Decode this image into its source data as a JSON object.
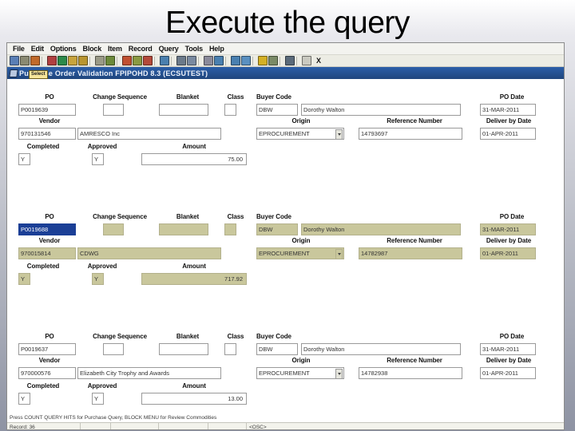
{
  "slide": {
    "title": "Execute the query"
  },
  "window": {
    "title": "Purchase Order Validation  FPIPOHD 8.3  (ECSUTEST)",
    "tooltip": "Select"
  },
  "menubar": {
    "items": [
      "File",
      "Edit",
      "Options",
      "Block",
      "Item",
      "Record",
      "Query",
      "Tools",
      "Help"
    ]
  },
  "toolbar": {
    "close_label": "X",
    "icons": [
      {
        "name": "save-icon",
        "color": "#5a7fb5"
      },
      {
        "name": "rollback-icon",
        "color": "#8a8a72"
      },
      {
        "name": "print-icon",
        "color": "#c06a2a"
      },
      {
        "name": "cut-icon",
        "color": "#b04040"
      },
      {
        "name": "copy-icon",
        "color": "#2d8a4a"
      },
      {
        "name": "paste-icon",
        "color": "#c8a43c"
      },
      {
        "name": "select-all-icon",
        "color": "#b8952f"
      },
      {
        "name": "enter-query-icon",
        "color": "#9a9a86"
      },
      {
        "name": "execute-query-icon",
        "color": "#6c8a3a"
      },
      {
        "name": "cancel-query-icon",
        "color": "#c05030"
      },
      {
        "name": "insert-record-icon",
        "color": "#8a9a42"
      },
      {
        "name": "remove-record-icon",
        "color": "#b44a3a"
      },
      {
        "name": "duplicate-record-icon",
        "color": "#4a7fae"
      },
      {
        "name": "list-values-icon",
        "color": "#6b7a8a"
      },
      {
        "name": "edit-icon",
        "color": "#7a8aa0"
      },
      {
        "name": "show-keys-icon",
        "color": "#8a8a9a"
      },
      {
        "name": "previous-block-icon",
        "color": "#4a80b0"
      },
      {
        "name": "next-block-icon",
        "color": "#4a80b0"
      },
      {
        "name": "previous-item-icon",
        "color": "#5a90c0"
      },
      {
        "name": "next-item-icon",
        "color": "#d4b024"
      },
      {
        "name": "exit-icon",
        "color": "#7a8a66"
      },
      {
        "name": "help-icon",
        "color": "#5a6a7a"
      },
      {
        "name": "window-icon",
        "color": "#c9c9c0"
      }
    ]
  },
  "form": {
    "labels": {
      "po": "PO",
      "change_sequence": "Change Sequence",
      "blanket": "Blanket",
      "class": "Class",
      "buyer_code": "Buyer Code",
      "po_date": "PO Date",
      "vendor": "Vendor",
      "origin": "Origin",
      "reference_number": "Reference Number",
      "deliver_by_date": "Deliver by Date",
      "completed": "Completed",
      "approved": "Approved",
      "amount": "Amount"
    },
    "records": [
      {
        "po": "P0019639",
        "change_sequence": "",
        "blanket": "",
        "class": "",
        "buyer_code": "DBW",
        "buyer_name": "Dorothy Walton",
        "po_date": "31-MAR-2011",
        "vendor_id": "970131546",
        "vendor_name": "AMRESCO Inc",
        "origin": "EPROCUREMENT",
        "reference_number": "14793697",
        "deliver_by_date": "01-APR-2011",
        "completed": "Y",
        "approved": "Y",
        "amount": "75.00",
        "current": false
      },
      {
        "po": "P0019688",
        "change_sequence": "",
        "blanket": "",
        "class": "",
        "buyer_code": "DBW",
        "buyer_name": "Dorothy Walton",
        "po_date": "31-MAR-2011",
        "vendor_id": "970015814",
        "vendor_name": "CDWG",
        "origin": "EPROCUREMENT",
        "reference_number": "14782987",
        "deliver_by_date": "01-APR-2011",
        "completed": "Y",
        "approved": "Y",
        "amount": "717.92",
        "current": true
      },
      {
        "po": "P0019637",
        "change_sequence": "",
        "blanket": "",
        "class": "",
        "buyer_code": "DBW",
        "buyer_name": "Dorothy Walton",
        "po_date": "31-MAR-2011",
        "vendor_id": "970000576",
        "vendor_name": "Elizabeth City Trophy and Awards",
        "origin": "EPROCUREMENT",
        "reference_number": "14782938",
        "deliver_by_date": "01-APR-2011",
        "completed": "Y",
        "approved": "Y",
        "amount": "13.00",
        "current": false
      }
    ]
  },
  "status": {
    "message": "Press COUNT QUERY HITS for Purchase Query, BLOCK MENU for Review Commodities",
    "record": "Record: 36",
    "cell2": "",
    "cell3": "",
    "cell4": "",
    "cell5": "",
    "mode": "<OSC>"
  },
  "colors": {
    "title_bar": "#20467d",
    "current_record": "#c9c79c",
    "selection": "#1b3f96"
  }
}
